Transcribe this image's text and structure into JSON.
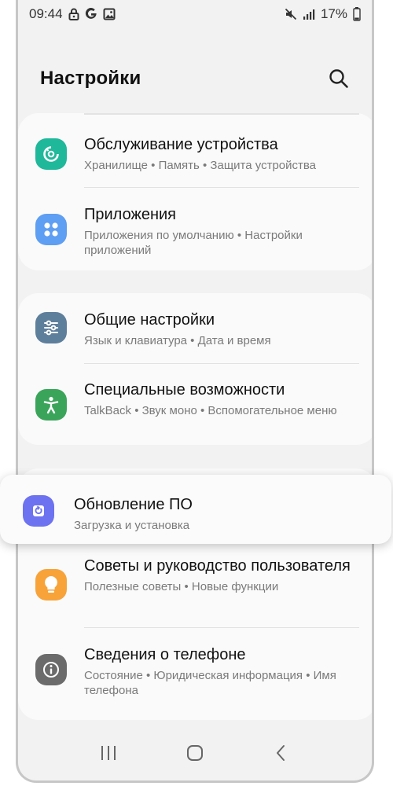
{
  "status_bar": {
    "time": "09:44",
    "left_icons": [
      "lock-icon",
      "google-icon",
      "image-icon"
    ],
    "right_icons": [
      "mute-icon",
      "signal-icon"
    ],
    "battery": "17%"
  },
  "header": {
    "title": "Настройки",
    "search_icon": "search-icon"
  },
  "sections": [
    {
      "items": [
        {
          "title": "Обслуживание устройства",
          "subtitle": "Хранилище • Память • Защита устройства",
          "icon": "device-care-icon",
          "color": "#1fb89a"
        },
        {
          "title": "Приложения",
          "subtitle": "Приложения по умолчанию • Настройки приложений",
          "icon": "apps-icon",
          "color": "#5e9ef3"
        }
      ]
    },
    {
      "items": [
        {
          "title": "Общие настройки",
          "subtitle": "Язык и клавиатура • Дата и время",
          "icon": "sliders-icon",
          "color": "#5e7f9c"
        },
        {
          "title": "Специальные возможности",
          "subtitle": "TalkBack • Звук моно • Вспомогательное меню",
          "icon": "accessibility-icon",
          "color": "#3aa55a"
        }
      ]
    },
    {
      "items": [
        {
          "title": "Советы и руководство пользователя",
          "subtitle": "Полезные советы • Новые функции",
          "icon": "lightbulb-icon",
          "color": "#f7a33a"
        },
        {
          "title": "Сведения о телефоне",
          "subtitle": "Состояние • Юридическая информация • Имя телефона",
          "icon": "info-icon",
          "color": "#6b6b6b"
        }
      ]
    }
  ],
  "highlighted_item": {
    "title": "Обновление ПО",
    "subtitle": "Загрузка и установка",
    "icon": "software-update-icon",
    "color": "#6d72f0"
  },
  "nav_bar": {
    "buttons": [
      "recents-icon",
      "home-icon",
      "back-icon"
    ]
  }
}
